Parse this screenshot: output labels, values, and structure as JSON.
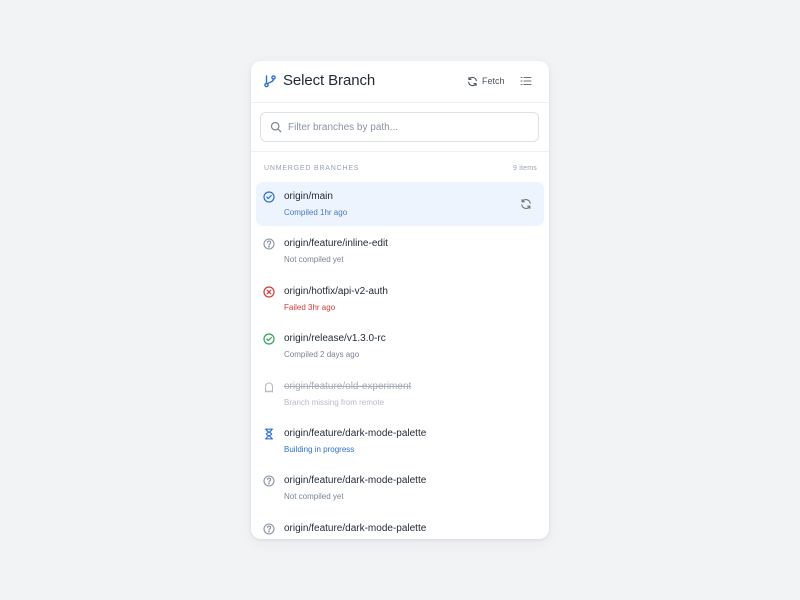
{
  "header": {
    "title": "Select Branch",
    "fetch_label": "Fetch",
    "icons": {
      "branch": "git-branch-icon",
      "fetch": "refresh-icon",
      "list": "list-icon"
    }
  },
  "search": {
    "placeholder": "Filter branches by path...",
    "value": ""
  },
  "section": {
    "title": "UNMERGED BRANCHES",
    "count": "9 items"
  },
  "colors": {
    "accent": "#2d6fd1",
    "selected_bg": "#edf4fd",
    "success": "#2fa55a",
    "failed": "#d23c3c",
    "muted": "#8a94a3"
  },
  "branches": [
    {
      "name": "origin/main",
      "status": "Compiled 1hr ago",
      "state": "compiled-selected",
      "icon": "check-circle-icon",
      "selected": true
    },
    {
      "name": "origin/feature/inline-edit",
      "status": "Not compiled yet",
      "state": "unknown",
      "icon": "question-circle-icon"
    },
    {
      "name": "origin/hotfix/api-v2-auth",
      "status": "Failed 3hr ago",
      "state": "failed",
      "icon": "x-circle-icon"
    },
    {
      "name": "origin/release/v1.3.0-rc",
      "status": "Compiled 2 days ago",
      "state": "compiled",
      "icon": "check-circle-icon"
    },
    {
      "name": "origin/feature/old-experiment",
      "status": "Branch missing from remote",
      "state": "missing",
      "icon": "ghost-icon"
    },
    {
      "name": "origin/feature/dark-mode-palette",
      "status": "Building in progress",
      "state": "building",
      "icon": "hourglass-icon"
    },
    {
      "name": "origin/feature/dark-mode-palette",
      "status": "Not compiled yet",
      "state": "unknown",
      "icon": "question-circle-icon"
    },
    {
      "name": "origin/feature/dark-mode-palette",
      "status": "",
      "state": "unknown",
      "icon": "question-circle-icon"
    }
  ]
}
